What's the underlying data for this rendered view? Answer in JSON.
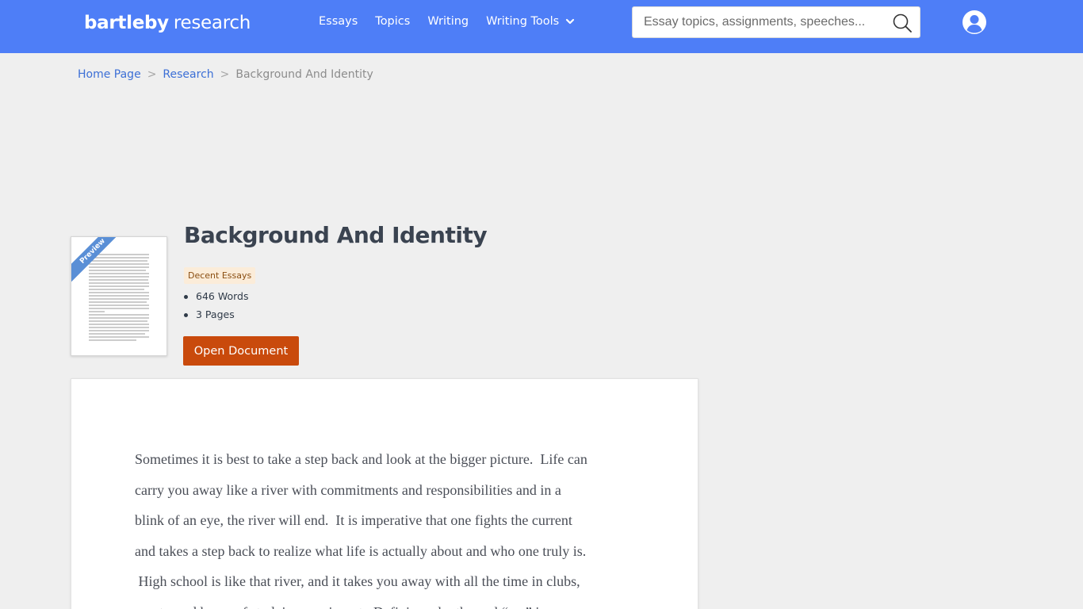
{
  "header": {
    "logo_bold": "bartleby",
    "logo_light": "research",
    "nav": [
      {
        "label": "Essays"
      },
      {
        "label": "Topics"
      },
      {
        "label": "Writing"
      },
      {
        "label": "Writing Tools"
      }
    ],
    "search_placeholder": "Essay topics, assignments, speeches..."
  },
  "breadcrumb": {
    "items": [
      "Home Page",
      "Research"
    ],
    "separator": ">",
    "current": "Background And Identity"
  },
  "thumbnail": {
    "ribbon_label": "Preview"
  },
  "document": {
    "title": "Background And Identity",
    "badge": "Decent Essays",
    "stats": [
      "646 Words",
      "3 Pages"
    ],
    "open_label": "Open Document",
    "lines": [
      "Sometimes it is best to take a step back and look at the bigger picture.  Life can",
      "carry you away like a river with commitments and responsibilities and in a",
      "blink of an eye, the river will end.  It is imperative that one fights the current",
      "and takes a step back to realize what life is actually about and who one truly is.",
      " High school is like that river, and it takes you away with all the time in clubs,",
      "sports, and hours of studying you invest.  Defining who the real “me” is"
    ]
  },
  "colors": {
    "header_bg": "#4e7ef7",
    "link": "#3c6fd6",
    "button_bg": "#c94a0c",
    "badge_bg": "#fbecd9",
    "page_bg": "#efefef"
  }
}
